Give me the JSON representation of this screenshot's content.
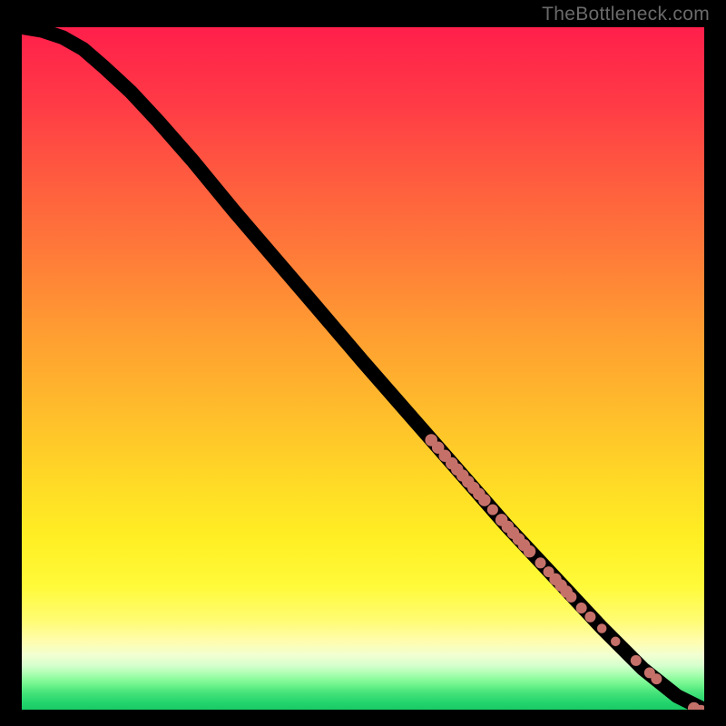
{
  "watermark": "TheBottleneck.com",
  "chart_data": {
    "type": "line",
    "title": "",
    "xlabel": "",
    "ylabel": "",
    "xlim": [
      0,
      100
    ],
    "ylim": [
      0,
      100
    ],
    "curve_points": [
      {
        "x": 0.0,
        "y": 100.0
      },
      {
        "x": 3.0,
        "y": 99.5
      },
      {
        "x": 6.0,
        "y": 98.5
      },
      {
        "x": 9.0,
        "y": 96.8
      },
      {
        "x": 12.0,
        "y": 94.2
      },
      {
        "x": 16.0,
        "y": 90.5
      },
      {
        "x": 20.0,
        "y": 86.2
      },
      {
        "x": 25.0,
        "y": 80.5
      },
      {
        "x": 31.0,
        "y": 73.2
      },
      {
        "x": 37.0,
        "y": 66.2
      },
      {
        "x": 43.0,
        "y": 59.2
      },
      {
        "x": 50.0,
        "y": 51.0
      },
      {
        "x": 57.0,
        "y": 43.0
      },
      {
        "x": 64.0,
        "y": 35.0
      },
      {
        "x": 71.0,
        "y": 27.0
      },
      {
        "x": 78.0,
        "y": 19.5
      },
      {
        "x": 85.0,
        "y": 12.0
      },
      {
        "x": 91.0,
        "y": 6.0
      },
      {
        "x": 96.0,
        "y": 2.0
      },
      {
        "x": 100.0,
        "y": 0.0
      }
    ],
    "markers": [
      {
        "x": 60.0,
        "y": 39.5,
        "r": 0.9
      },
      {
        "x": 61.0,
        "y": 38.4,
        "r": 0.9
      },
      {
        "x": 62.0,
        "y": 37.2,
        "r": 0.9
      },
      {
        "x": 63.0,
        "y": 36.1,
        "r": 0.9
      },
      {
        "x": 63.8,
        "y": 35.2,
        "r": 0.9
      },
      {
        "x": 64.6,
        "y": 34.3,
        "r": 0.9
      },
      {
        "x": 65.4,
        "y": 33.4,
        "r": 0.9
      },
      {
        "x": 66.2,
        "y": 32.5,
        "r": 0.9
      },
      {
        "x": 67.0,
        "y": 31.6,
        "r": 0.9
      },
      {
        "x": 67.8,
        "y": 30.7,
        "r": 0.9
      },
      {
        "x": 69.0,
        "y": 29.3,
        "r": 0.8
      },
      {
        "x": 70.3,
        "y": 27.8,
        "r": 0.9
      },
      {
        "x": 71.2,
        "y": 26.8,
        "r": 0.9
      },
      {
        "x": 72.0,
        "y": 25.9,
        "r": 0.9
      },
      {
        "x": 72.8,
        "y": 25.0,
        "r": 0.9
      },
      {
        "x": 73.6,
        "y": 24.1,
        "r": 0.9
      },
      {
        "x": 74.4,
        "y": 23.2,
        "r": 0.9
      },
      {
        "x": 76.0,
        "y": 21.5,
        "r": 0.8
      },
      {
        "x": 77.2,
        "y": 20.2,
        "r": 0.8
      },
      {
        "x": 78.2,
        "y": 19.1,
        "r": 0.9
      },
      {
        "x": 79.0,
        "y": 18.2,
        "r": 0.9
      },
      {
        "x": 79.8,
        "y": 17.3,
        "r": 0.9
      },
      {
        "x": 80.5,
        "y": 16.5,
        "r": 0.8
      },
      {
        "x": 82.0,
        "y": 14.9,
        "r": 0.8
      },
      {
        "x": 83.3,
        "y": 13.6,
        "r": 0.8
      },
      {
        "x": 85.0,
        "y": 11.9,
        "r": 0.7
      },
      {
        "x": 87.0,
        "y": 10.0,
        "r": 0.7
      },
      {
        "x": 90.0,
        "y": 7.2,
        "r": 0.8
      },
      {
        "x": 92.0,
        "y": 5.4,
        "r": 0.8
      },
      {
        "x": 93.0,
        "y": 4.5,
        "r": 0.8
      },
      {
        "x": 98.5,
        "y": 0.2,
        "r": 0.9
      },
      {
        "x": 99.5,
        "y": -0.2,
        "r": 0.9
      },
      {
        "x": 100.5,
        "y": -0.2,
        "r": 0.9
      }
    ],
    "gradient_bands": [
      {
        "pos": 0.0,
        "color": "#ff1f4b"
      },
      {
        "pos": 0.5,
        "color": "#ffb92c"
      },
      {
        "pos": 0.75,
        "color": "#ffef24"
      },
      {
        "pos": 0.92,
        "color": "#d6ffcd"
      },
      {
        "pos": 1.0,
        "color": "#1acb66"
      }
    ]
  }
}
